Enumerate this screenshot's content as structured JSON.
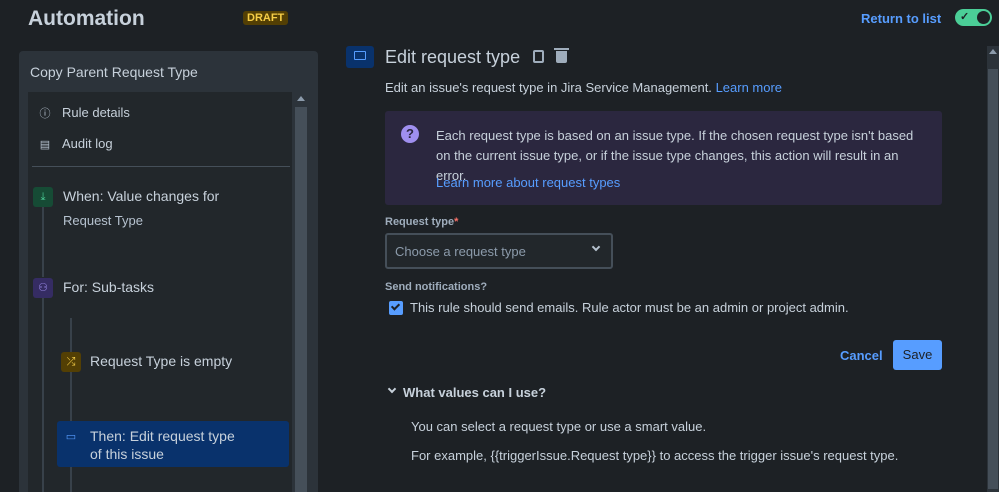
{
  "header": {
    "title": "Automation",
    "draft_badge": "DRAFT",
    "return_link": "Return to list",
    "toggle_state": "on"
  },
  "sidebar": {
    "title": "Copy Parent Request Type",
    "menu": [
      {
        "label": "Rule details",
        "icon": "info-icon"
      },
      {
        "label": "Audit log",
        "icon": "document-icon"
      }
    ],
    "nodes": [
      {
        "label": "When: Value changes for",
        "sub": "Request Type",
        "icon": "trigger-icon",
        "color": "#4bce97"
      },
      {
        "label": "For: Sub-tasks",
        "icon": "branch-icon",
        "color": "#9f8fef"
      },
      {
        "label": "Request Type is empty",
        "icon": "condition-icon",
        "color": "#f5cd47"
      },
      {
        "label": "Then: Edit request type",
        "label2": "of this issue",
        "icon": "action-icon",
        "color": "#579dff",
        "selected": true
      }
    ]
  },
  "main": {
    "heading": "Edit request type",
    "description": "Edit an issue's request type in Jira Service Management.",
    "description_link": "Learn more",
    "info": {
      "text": "Each request type is based on an issue type. If the chosen request type isn't based on the current issue type, or if the issue type changes, this action will result in an error.",
      "link": "Learn more about request types"
    },
    "request_type": {
      "label": "Request type",
      "required_mark": "*",
      "placeholder": "Choose a request type"
    },
    "notifications": {
      "label": "Send notifications?",
      "checkbox_label": "This rule should send emails. Rule actor must be an admin or project admin.",
      "checked": true
    },
    "cancel_label": "Cancel",
    "save_label": "Save",
    "expander": {
      "title": "What values can I use?",
      "p1": "You can select a request type or use a smart value.",
      "p2": "For example, {{triggerIssue.Request type}} to access the trigger issue's request type."
    }
  }
}
